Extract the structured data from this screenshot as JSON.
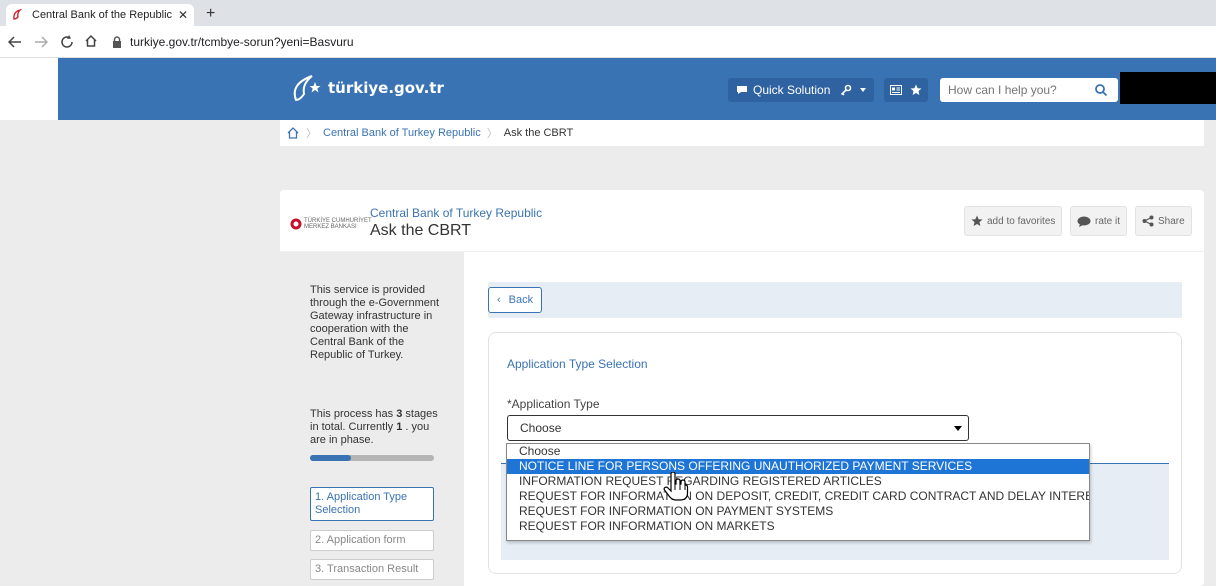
{
  "browser": {
    "tab_title": "Central Bank of the Republic of T",
    "new_tab": "+",
    "close": "✕",
    "url": "turkiye.gov.tr/tcmbye-sorun?yeni=Basvuru"
  },
  "header": {
    "logo_text": "türkiye.gov.tr",
    "quick_solution": "Quick Solution",
    "search_placeholder": "How can I help you?"
  },
  "breadcrumb": [
    "Central Bank of Turkey Republic",
    "Ask the CBRT"
  ],
  "card": {
    "subtitle": "Central Bank of Turkey Republic",
    "title": "Ask the CBRT",
    "logo_text_line1": "TÜRKİYE CUMHURİYET",
    "logo_text_line2": "MERKEZ BANKASI",
    "actions": {
      "favorites": "add to favorites",
      "rate": "rate it",
      "share": "Share"
    }
  },
  "sidebar": {
    "info": "This service is provided through the e-Government Gateway infrastructure in cooperation with the Central Bank of the Republic of Turkey.",
    "process_prefix": "This process has ",
    "total_stages": "3",
    "process_middle": " stages in total. Currently ",
    "current_stage": "1",
    "process_suffix": " . you are in phase.",
    "progress_fraction": 0.33,
    "stages": [
      "1. Application Type Selection",
      "2. Application form",
      "3. Transaction Result"
    ]
  },
  "content": {
    "back": "Back",
    "section_title": "Application Type Selection",
    "field_label": "*Application Type",
    "selected": "Choose",
    "options": [
      "Choose",
      "NOTICE LINE FOR PERSONS OFFERING UNAUTHORIZED PAYMENT SERVICES",
      "INFORMATION REQUEST REGARDING REGISTERED ARTICLES",
      "REQUEST FOR INFORMATION ON DEPOSIT, CREDIT, CREDIT CARD CONTRACT AND DELAY INTEREST RATES",
      "REQUEST FOR INFORMATION ON PAYMENT SYSTEMS",
      "REQUEST FOR INFORMATION ON MARKETS"
    ],
    "highlighted_index": 1
  },
  "colors": {
    "brand_blue": "#3a73b3",
    "highlight_blue": "#1e75d6"
  },
  "icons": [
    "back-arrow-icon",
    "forward-arrow-icon",
    "reload-icon",
    "home-icon",
    "lock-icon",
    "search-icon",
    "star-icon",
    "key-icon",
    "chat-icon",
    "share-icon",
    "hand-cursor-icon"
  ]
}
